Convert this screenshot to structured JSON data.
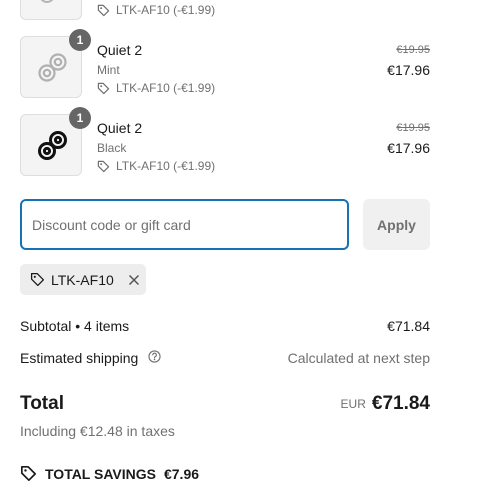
{
  "items": [
    {
      "name": "",
      "variant": "",
      "discount": "LTK-AF10 (-€1.99)",
      "original_price": "",
      "price": "",
      "quantity": ""
    },
    {
      "name": "Quiet 2",
      "variant": "Mint",
      "discount": "LTK-AF10 (-€1.99)",
      "original_price": "€19.95",
      "price": "€17.96",
      "quantity": "1",
      "image_icon": "earplug-white-icon"
    },
    {
      "name": "Quiet 2",
      "variant": "Black",
      "discount": "LTK-AF10 (-€1.99)",
      "original_price": "€19.95",
      "price": "€17.96",
      "quantity": "1",
      "image_icon": "earplug-black-icon"
    }
  ],
  "discount": {
    "placeholder": "Discount code or gift card",
    "value": "",
    "apply_label": "Apply",
    "applied_code": "LTK-AF10"
  },
  "summary": {
    "subtotal_label": "Subtotal • 4 items",
    "subtotal_value": "€71.84",
    "shipping_label": "Estimated shipping",
    "shipping_value": "Calculated at next step",
    "total_label": "Total",
    "currency": "EUR",
    "total_value": "€71.84",
    "taxes_note": "Including €12.48 in taxes",
    "savings_label": "TOTAL SAVINGS",
    "savings_value": "€7.96"
  },
  "colors": {
    "accent": "#1773b0",
    "badge": "#666666",
    "chip_bg": "#ededed"
  }
}
